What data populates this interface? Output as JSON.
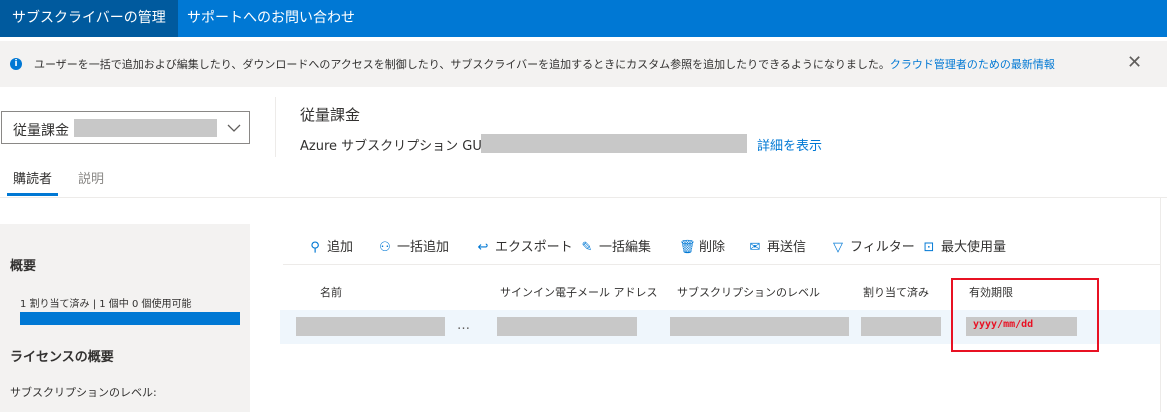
{
  "top_tabs": [
    "サブスクライバーの管理",
    "サポートへのお問い合わせ"
  ],
  "notice": {
    "text": "ユーザーを一括で追加および編集したり、ダウンロードへのアクセスを制御したり、サブスクライバーを追加するときにカスタム参照を追加したりできるようになりました。",
    "link": "クラウド管理者のための最新情報",
    "close": "✕"
  },
  "subscription_dropdown": {
    "label": "従量課金"
  },
  "header": {
    "title": "従量課金",
    "guid_label": "Azure サブスクリプション GUID:",
    "details_link": "詳細を表示"
  },
  "page_tabs": [
    "購読者",
    "説明"
  ],
  "sidebar": {
    "overview": "概要",
    "usage": "1 割り当て済み | 1 個中 0 個使用可能",
    "usage_fraction": 1.0,
    "license_overview": "ライセンスの概要",
    "subscription_level": "サブスクリプションのレベル:"
  },
  "toolbar": [
    {
      "label": "追加",
      "icon": "add-person-icon",
      "glyph": "⚲"
    },
    {
      "label": "一括追加",
      "icon": "bulk-add-icon",
      "glyph": "⚇"
    },
    {
      "label": "エクスポート",
      "icon": "export-icon",
      "glyph": "↩"
    },
    {
      "label": "一括編集",
      "icon": "bulk-edit-icon",
      "glyph": "✎"
    },
    {
      "label": "削除",
      "icon": "delete-icon",
      "glyph": "🗑"
    },
    {
      "label": "再送信",
      "icon": "mail-icon",
      "glyph": "✉"
    },
    {
      "label": "フィルター",
      "icon": "filter-icon",
      "glyph": "▽"
    },
    {
      "label": "最大使用量",
      "icon": "chart-icon",
      "glyph": "⊡"
    }
  ],
  "table": {
    "columns": [
      "名前",
      "サインイン電子メール アドレス",
      "サブスクリプションのレベル",
      "割り当て済み",
      "有効期限"
    ],
    "rows": [
      {
        "more": "…",
        "expiration": "yyyy/mm/dd"
      }
    ]
  },
  "colors": {
    "accent": "#0078d4",
    "highlight": "#e81123"
  }
}
